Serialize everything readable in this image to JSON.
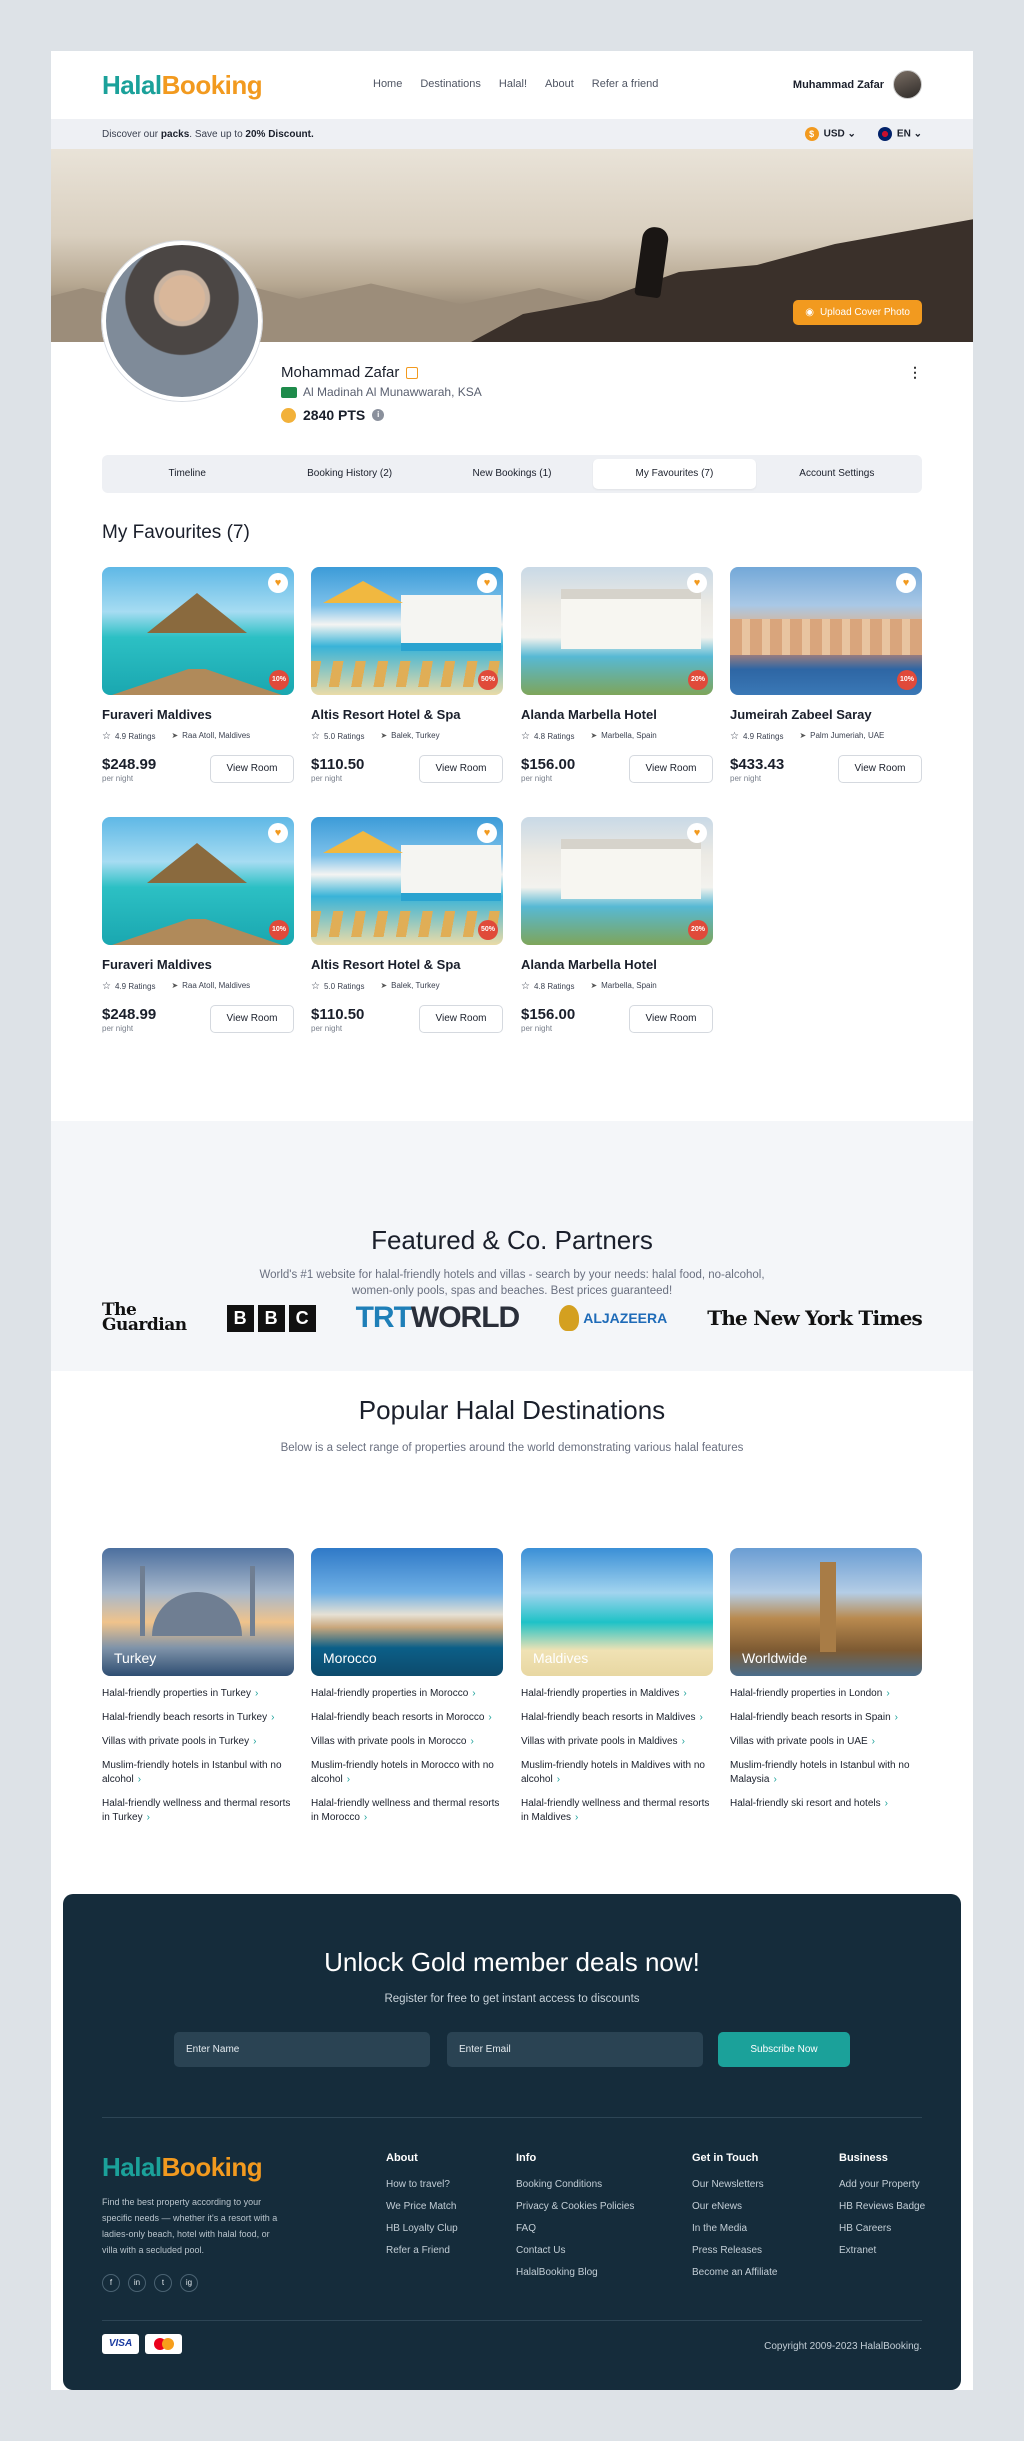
{
  "header": {
    "logo_part1": "Halal",
    "logo_part2": "Booking",
    "nav": [
      "Home",
      "Destinations",
      "Halal!",
      "About",
      "Refer a friend"
    ],
    "user_name": "Muhammad Zafar"
  },
  "promo": {
    "text_prefix": "Discover our ",
    "bold1": "packs",
    "text_mid": ". Save up to ",
    "bold2": "20% Discount.",
    "currency": "USD",
    "language": "EN"
  },
  "profile": {
    "upload_label": "Upload Cover Photo",
    "name": "Mohammad Zafar",
    "location": "Al Madinah Al Munawwarah, KSA",
    "points": "2840 PTS"
  },
  "tabs": [
    "Timeline",
    "Booking History (2)",
    "New Bookings (1)",
    "My Favourites (7)",
    "Account Settings"
  ],
  "favourites": {
    "title": "My Favourites (7)",
    "per_night": "per night",
    "view_label": "View Room",
    "items": [
      {
        "name": "Furaveri Maldives",
        "ratings": "4.9 Ratings",
        "location": "Raa Atoll, Maldives",
        "price": "$248.99",
        "badge": "10%"
      },
      {
        "name": "Altis Resort Hotel & Spa",
        "ratings": "5.0 Ratings",
        "location": "Balek, Turkey",
        "price": "$110.50",
        "badge": "50%"
      },
      {
        "name": "Alanda Marbella Hotel",
        "ratings": "4.8 Ratings",
        "location": "Marbella, Spain",
        "price": "$156.00",
        "badge": "20%"
      },
      {
        "name": "Jumeirah Zabeel Saray",
        "ratings": "4.9 Ratings",
        "location": "Palm Jumeriah, UAE",
        "price": "$433.43",
        "badge": "10%"
      },
      {
        "name": "Furaveri Maldives",
        "ratings": "4.9 Ratings",
        "location": "Raa Atoll, Maldives",
        "price": "$248.99",
        "badge": "10%"
      },
      {
        "name": "Altis Resort Hotel & Spa",
        "ratings": "5.0 Ratings",
        "location": "Balek, Turkey",
        "price": "$110.50",
        "badge": "50%"
      },
      {
        "name": "Alanda Marbella Hotel",
        "ratings": "4.8 Ratings",
        "location": "Marbella, Spain",
        "price": "$156.00",
        "badge": "20%"
      }
    ]
  },
  "partners": {
    "title": "Featured & Co. Partners",
    "subtitle_line1": "World's #1 website for halal-friendly hotels and villas - search by your needs: halal food, no-alcohol,",
    "subtitle_line2": "women-only pools, spas and beaches. Best prices guaranteed!",
    "logos": {
      "guardian1": "The",
      "guardian2": "Guardian",
      "bbc": [
        "B",
        "B",
        "C"
      ],
      "trt1": "TRT",
      "trt2": "WORLD",
      "aljazeera": "ALJAZEERA",
      "nyt": "The New York Times"
    }
  },
  "destinations": {
    "title": "Popular Halal Destinations",
    "subtitle": "Below is a select range of properties around the world demonstrating various halal features",
    "items": [
      {
        "label": "Turkey",
        "links": [
          "Halal-friendly properties in Turkey",
          "Halal-friendly beach resorts in Turkey",
          "Villas with private pools in Turkey",
          "Muslim-friendly hotels in Istanbul with no alcohol",
          "Halal-friendly wellness and thermal resorts in Turkey"
        ]
      },
      {
        "label": "Morocco",
        "links": [
          "Halal-friendly properties in Morocco",
          "Halal-friendly beach resorts in Morocco",
          "Villas with private pools in Morocco",
          "Muslim-friendly hotels in Morocco with no alcohol",
          "Halal-friendly wellness and thermal resorts in Morocco"
        ]
      },
      {
        "label": "Maldives",
        "links": [
          "Halal-friendly properties in Maldives",
          "Halal-friendly beach resorts in Maldives",
          "Villas with private pools in Maldives",
          "Muslim-friendly hotels in Maldives with no alcohol",
          "Halal-friendly wellness and thermal resorts in Maldives"
        ]
      },
      {
        "label": "Worldwide",
        "links": [
          "Halal-friendly properties in London",
          "Halal-friendly beach resorts in Spain",
          "Villas with private pools in UAE",
          "Muslim-friendly hotels in Istanbul with no Malaysia",
          "Halal-friendly ski resort and hotels"
        ]
      }
    ]
  },
  "footer": {
    "cta_title": "Unlock Gold member deals now!",
    "cta_subtitle": "Register for free to get instant access to discounts",
    "name_placeholder": "Enter Name",
    "email_placeholder": "Enter Email",
    "subscribe": "Subscribe Now",
    "description": "Find the best property according to your specific needs — whether it's a resort with a ladies-only beach, hotel with halal food, or villa with a secluded pool.",
    "social": [
      "f",
      "in",
      "t",
      "ig"
    ],
    "columns": [
      {
        "title": "About",
        "items": [
          "How to travel?",
          "We Price Match",
          "HB Loyalty Clup",
          "Refer a Friend"
        ]
      },
      {
        "title": "Info",
        "items": [
          "Booking Conditions",
          "Privacy & Cookies Policies",
          "FAQ",
          "Contact Us",
          "HalalBooking Blog"
        ]
      },
      {
        "title": "Get in Touch",
        "items": [
          "Our Newsletters",
          "Our eNews",
          "In the Media",
          "Press Releases",
          "Become an Affiliate"
        ]
      },
      {
        "title": "Business",
        "items": [
          "Add your Property",
          "HB Reviews Badge",
          "HB Careers",
          "Extranet"
        ]
      }
    ],
    "visa": "VISA",
    "copyright": "Copyright 2009-2023 HalalBooking."
  },
  "colors": {
    "teal": "#1ba19a",
    "orange": "#f29a1f",
    "navy": "#152c3b"
  }
}
